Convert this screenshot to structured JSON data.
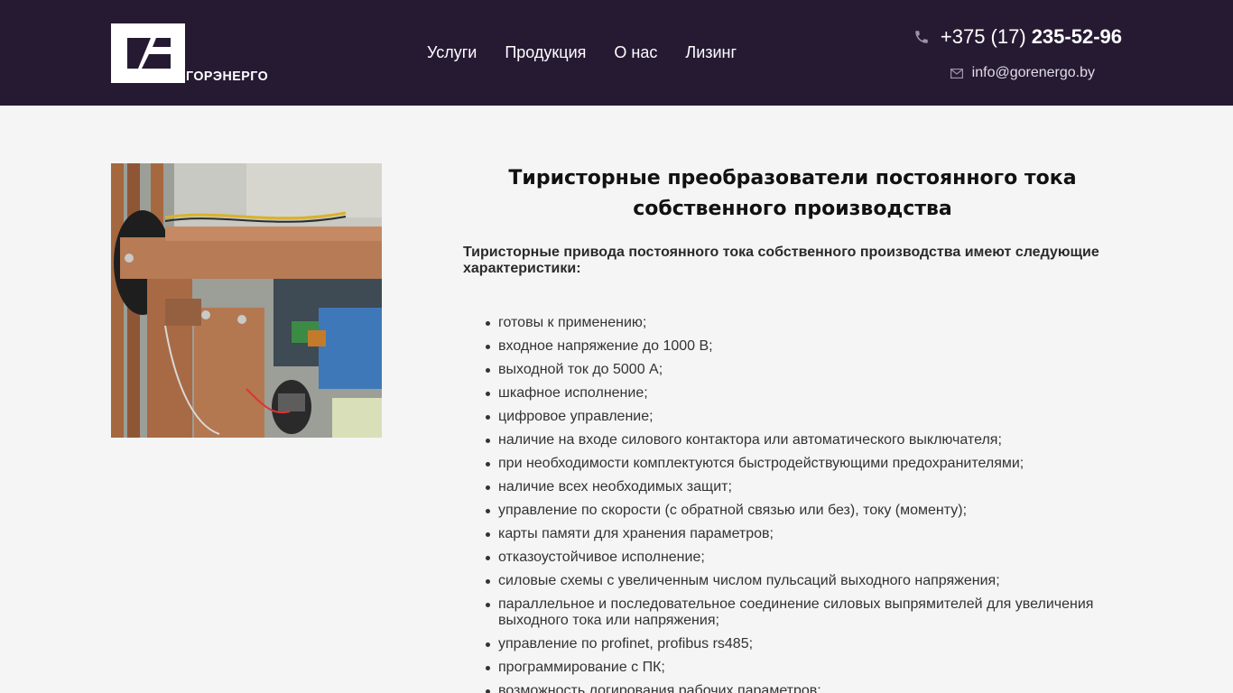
{
  "header": {
    "logo_text": "ГОРЭНЕРГО",
    "nav": [
      "Услуги",
      "Продукция",
      "О нас",
      "Лизинг"
    ],
    "phone_prefix": "+375 (17)",
    "phone_number": "235-52-96",
    "email": "info@gorenergo.by",
    "background_color": "#261a33"
  },
  "main": {
    "title": "Тиристорные преобразователи постоянного тока собственного производства",
    "intro": "Тиристорные привода постоянного тока собственного производства имеют следующие характеристики:",
    "features": [
      "готовы к применению;",
      "входное напряжение до 1000 В;",
      "выходной ток до 5000 А;",
      "шкафное исполнение;",
      "цифровое управление;",
      "наличие на входе силового контактора или автоматического выключателя;",
      "при необходимости комплектуются быстродействующими предохранителями;",
      "наличие всех необходимых защит;",
      "управление по скорости (с обратной связью или без), току (моменту);",
      "карты памяти для хранения параметров;",
      "отказоустойчивое исполнение;",
      "силовые схемы с увеличенным числом пульсаций выходного напряжения;",
      "параллельное и последовательное соединение силовых выпрямителей для увеличения выходного тока или напряжения;",
      "управление по profinet, profibus rs485;",
      "программирование с ПК;",
      "возможность логирования рабочих параметров;"
    ]
  },
  "icons": {
    "phone": "phone-icon",
    "email": "mail-icon"
  }
}
